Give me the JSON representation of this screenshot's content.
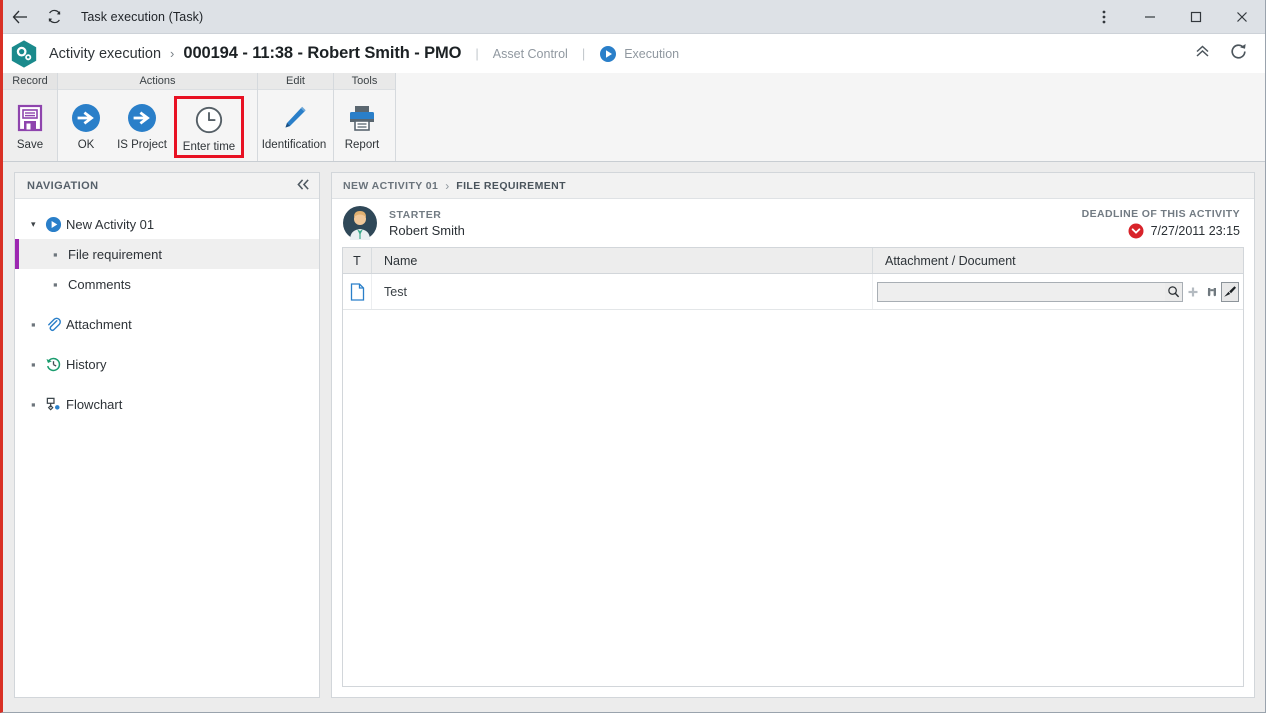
{
  "titlebar": {
    "back_icon": "arrow-left-icon",
    "refresh_icon": "refresh-icon",
    "title": "Task execution (Task)",
    "more_label": "⋮",
    "minimize_label": "–",
    "maximize_label": "☐",
    "close_label": "✕"
  },
  "header": {
    "logo_icon": "app-hexagon-logo",
    "module": "Activity execution",
    "chevron": "›",
    "record": "000194 - 11:38 - Robert Smith - PMO",
    "pipe": "|",
    "context": "Asset Control",
    "state": "Execution",
    "collapse_icon": "chevron-double-up-icon",
    "refresh_icon": "refresh-icon"
  },
  "ribbon": {
    "groups": [
      {
        "title": "Record",
        "buttons": [
          {
            "label": "Save",
            "icon": "save-floppy-icon",
            "highlighted": false
          }
        ]
      },
      {
        "title": "Actions",
        "buttons": [
          {
            "label": "OK",
            "icon": "arrow-circle-right-icon",
            "highlighted": false
          },
          {
            "label": "IS Project",
            "icon": "arrow-circle-right-icon",
            "highlighted": false
          },
          {
            "label": "Enter time",
            "icon": "clock-icon",
            "highlighted": true
          }
        ]
      },
      {
        "title": "Edit",
        "buttons": [
          {
            "label": "Identification",
            "icon": "pencil-icon",
            "highlighted": false
          }
        ]
      },
      {
        "title": "Tools",
        "buttons": [
          {
            "label": "Report",
            "icon": "printer-icon",
            "highlighted": false
          }
        ]
      }
    ],
    "highlight_color": "#e81123"
  },
  "navigation": {
    "title": "NAVIGATION",
    "collapse_icon": "chevron-double-left-icon",
    "items": [
      {
        "label": "New Activity 01",
        "level": 1,
        "icon": "play-circle-icon",
        "caret": "▾",
        "selected": false
      },
      {
        "label": "File requirement",
        "level": 2,
        "icon": "",
        "bullet": "▪",
        "selected": true
      },
      {
        "label": "Comments",
        "level": 2,
        "icon": "",
        "bullet": "▪",
        "selected": false
      },
      {
        "label": "Attachment",
        "level": 1,
        "icon": "paperclip-icon",
        "bullet": "▪",
        "selected": false
      },
      {
        "label": "History",
        "level": 1,
        "icon": "history-clock-icon",
        "bullet": "▪",
        "selected": false
      },
      {
        "label": "Flowchart",
        "level": 1,
        "icon": "flowchart-icon",
        "bullet": "▪",
        "selected": false
      }
    ],
    "selected_accent": "#9c27b0"
  },
  "main": {
    "breadcrumb": [
      "NEW ACTIVITY 01",
      "FILE REQUIREMENT"
    ],
    "breadcrumb_sep": "›",
    "starter": {
      "label": "STARTER",
      "name": "Robert Smith",
      "avatar_icon": "user-avatar-icon"
    },
    "deadline": {
      "label": "DEADLINE OF THIS ACTIVITY",
      "value": "7/27/2011 23:15",
      "status_icon": "red-chevron-down-circle-icon",
      "status_color": "#d8232a"
    },
    "grid": {
      "columns": [
        "T",
        "Name",
        "Attachment / Document"
      ],
      "rows": [
        {
          "type_icon": "document-icon",
          "name": "Test",
          "attachment_value": "",
          "attachment_placeholder": "",
          "buttons": [
            {
              "icon": "magnifier-icon",
              "enabled": true
            },
            {
              "icon": "plus-icon",
              "enabled": false
            },
            {
              "icon": "binoculars-icon",
              "enabled": true
            },
            {
              "icon": "brush-clear-icon",
              "enabled": true
            }
          ]
        }
      ]
    }
  }
}
